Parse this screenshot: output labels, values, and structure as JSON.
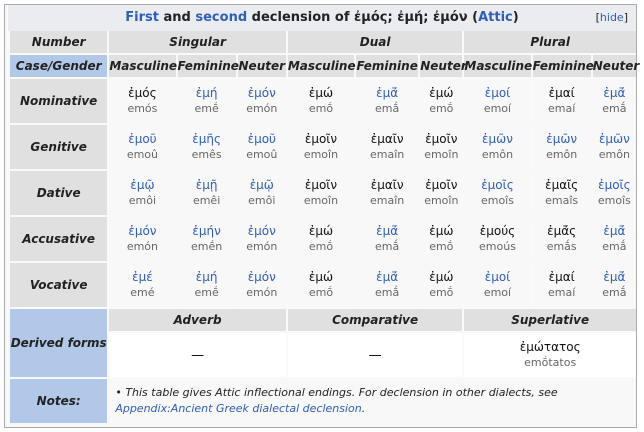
{
  "caption": {
    "first": "First",
    "and": " and ",
    "second": "second",
    "declension_of": " declension of ",
    "lemma1": "ἐμός",
    "sep1": "; ",
    "lemma2": "ἐμή",
    "sep2": "; ",
    "lemma3": "ἐμόν",
    "dialect_open": " (",
    "dialect": "Attic",
    "dialect_close": ")",
    "hide_open": "[",
    "hide": "hide",
    "hide_close": "]"
  },
  "headers": {
    "number": "Number",
    "case_gender": "Case/Gender",
    "singular": "Singular",
    "dual": "Dual",
    "plural": "Plural",
    "masculine": "Masculine",
    "feminine": "Feminine",
    "neuter": "Neuter"
  },
  "rows": [
    {
      "case": "Nominative",
      "cells": [
        {
          "g": "ἐμός",
          "t": "emós",
          "link": false
        },
        {
          "g": "ἐμή",
          "t": "emḗ",
          "link": true
        },
        {
          "g": "ἐμόν",
          "t": "emón",
          "link": true
        },
        {
          "g": "ἐμώ",
          "t": "emṓ",
          "link": false
        },
        {
          "g": "ἐμᾱ́",
          "t": "emā́",
          "link": true
        },
        {
          "g": "ἐμώ",
          "t": "emṓ",
          "link": false
        },
        {
          "g": "ἐμοί",
          "t": "emoí",
          "link": true
        },
        {
          "g": "ἐμαί",
          "t": "emaí",
          "link": false
        },
        {
          "g": "ἐμᾱ́",
          "t": "emā́",
          "link": true
        }
      ]
    },
    {
      "case": "Genitive",
      "cells": [
        {
          "g": "ἐμοῦ",
          "t": "emoû",
          "link": true
        },
        {
          "g": "ἐμῆς",
          "t": "emês",
          "link": true
        },
        {
          "g": "ἐμοῦ",
          "t": "emoû",
          "link": true
        },
        {
          "g": "ἐμοῖν",
          "t": "emoîn",
          "link": false
        },
        {
          "g": "ἐμαῖν",
          "t": "emaîn",
          "link": false
        },
        {
          "g": "ἐμοῖν",
          "t": "emoîn",
          "link": false
        },
        {
          "g": "ἐμῶν",
          "t": "emôn",
          "link": true
        },
        {
          "g": "ἐμῶν",
          "t": "emôn",
          "link": true
        },
        {
          "g": "ἐμῶν",
          "t": "emôn",
          "link": true
        }
      ]
    },
    {
      "case": "Dative",
      "cells": [
        {
          "g": "ἐμῷ",
          "t": "emôi",
          "link": true
        },
        {
          "g": "ἐμῇ",
          "t": "emêi",
          "link": true
        },
        {
          "g": "ἐμῷ",
          "t": "emôi",
          "link": true
        },
        {
          "g": "ἐμοῖν",
          "t": "emoîn",
          "link": false
        },
        {
          "g": "ἐμαῖν",
          "t": "emaîn",
          "link": false
        },
        {
          "g": "ἐμοῖν",
          "t": "emoîn",
          "link": false
        },
        {
          "g": "ἐμοῖς",
          "t": "emoîs",
          "link": true
        },
        {
          "g": "ἐμαῖς",
          "t": "emaîs",
          "link": false
        },
        {
          "g": "ἐμοῖς",
          "t": "emoîs",
          "link": true
        }
      ]
    },
    {
      "case": "Accusative",
      "cells": [
        {
          "g": "ἐμόν",
          "t": "emón",
          "link": true
        },
        {
          "g": "ἐμήν",
          "t": "emḗn",
          "link": true
        },
        {
          "g": "ἐμόν",
          "t": "emón",
          "link": true
        },
        {
          "g": "ἐμώ",
          "t": "emṓ",
          "link": false
        },
        {
          "g": "ἐμᾱ́",
          "t": "emā́",
          "link": true
        },
        {
          "g": "ἐμώ",
          "t": "emṓ",
          "link": false
        },
        {
          "g": "ἐμούς",
          "t": "emoús",
          "link": false
        },
        {
          "g": "ἐμᾱ́ς",
          "t": "emā́s",
          "link": false
        },
        {
          "g": "ἐμᾱ́",
          "t": "emā́",
          "link": true
        }
      ]
    },
    {
      "case": "Vocative",
      "cells": [
        {
          "g": "ἐμέ",
          "t": "emé",
          "link": true
        },
        {
          "g": "ἐμή",
          "t": "emḗ",
          "link": true
        },
        {
          "g": "ἐμόν",
          "t": "emón",
          "link": true
        },
        {
          "g": "ἐμώ",
          "t": "emṓ",
          "link": false
        },
        {
          "g": "ἐμᾱ́",
          "t": "emā́",
          "link": true
        },
        {
          "g": "ἐμώ",
          "t": "emṓ",
          "link": false
        },
        {
          "g": "ἐμοί",
          "t": "emoí",
          "link": true
        },
        {
          "g": "ἐμαί",
          "t": "emaí",
          "link": false
        },
        {
          "g": "ἐμᾱ́",
          "t": "emā́",
          "link": true
        }
      ]
    }
  ],
  "derived": {
    "label": "Derived forms",
    "adverb": "Adverb",
    "comparative": "Comparative",
    "superlative": "Superlative",
    "adverb_value": "—",
    "comparative_value": "—",
    "superlative_greek": "ἐμώτατος",
    "superlative_translit": "emṓtatos"
  },
  "notes": {
    "label": "Notes:",
    "text": "This table gives Attic inflectional endings. For declension in other dialects, see ",
    "link": "Appendix:Ancient Greek dialectal declension",
    "end": "."
  }
}
